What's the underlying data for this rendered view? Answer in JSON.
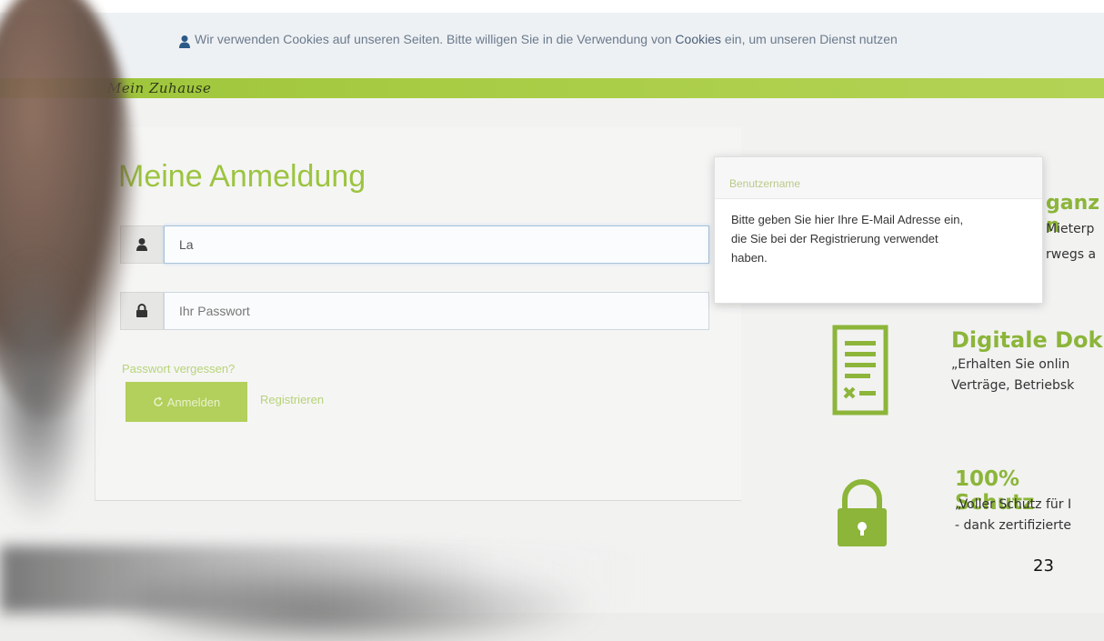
{
  "cookie_bar": {
    "icon": "user-icon",
    "text_before": "Wir verwenden Cookies auf unseren Seiten. Bitte willigen Sie in die Verwendung von ",
    "text_highlight": "Cookies",
    "text_after": " ein, um unseren Dienst nutzen"
  },
  "brand": {
    "name": "Mein Zuhause"
  },
  "login": {
    "title": "Meine Anmeldung",
    "username_icon": "user-icon",
    "username_value": "La",
    "password_icon": "lock-icon",
    "password_placeholder": "Ihr Passwort",
    "forgot_link": "Passwort vergessen?",
    "login_button_icon": "spinner-icon",
    "login_button": "Anmelden",
    "register_link": "Registrieren"
  },
  "tooltip": {
    "title": "Benutzername",
    "body": "Bitte geben Sie hier Ihre E-Mail Adresse ein, die Sie bei der Registrierung verwendet haben."
  },
  "features": [
    {
      "heading": "ganz n",
      "lines": [
        "Mieterp",
        "rwegs a"
      ]
    },
    {
      "icon": "document-icon",
      "heading": "Digitale Dok",
      "lines": [
        "„Erhalten Sie onlin",
        "Verträge, Betriebsk"
      ]
    },
    {
      "icon": "padlock-icon",
      "heading": "100% Schutz",
      "lines": [
        "„Voller Schutz für I",
        "- dank zertifizierte"
      ]
    }
  ],
  "page_number": "23",
  "colors": {
    "accent": "#9cc440",
    "brand_bar": "#a8cc44",
    "button": "#b3cf5c"
  }
}
